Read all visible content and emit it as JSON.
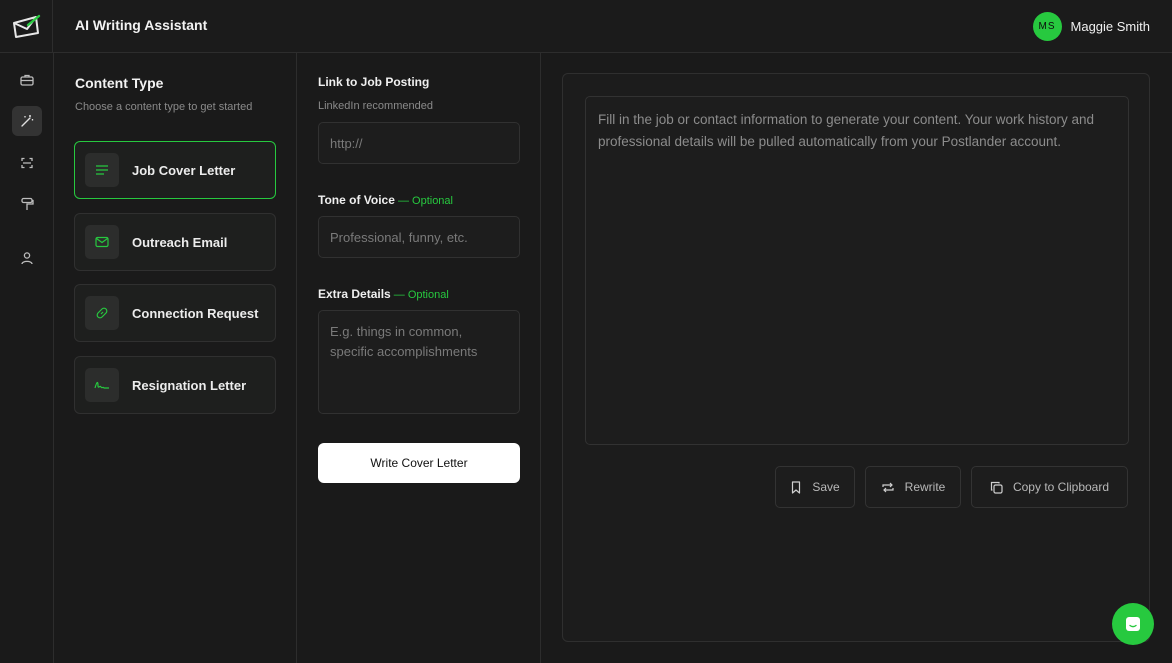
{
  "header": {
    "app_title": "AI Writing Assistant",
    "user": {
      "initials": "MS",
      "name": "Maggie Smith"
    }
  },
  "rail": {
    "icons": [
      "briefcase-icon",
      "magic-wand-icon",
      "scan-icon",
      "paint-roller-icon",
      "user-icon"
    ],
    "active": "magic-wand-icon"
  },
  "content_type": {
    "title": "Content Type",
    "subtitle": "Choose a content type to get started",
    "items": [
      {
        "label": "Job Cover Letter",
        "icon": "lines-icon",
        "selected": true
      },
      {
        "label": "Outreach Email",
        "icon": "mail-icon",
        "selected": false
      },
      {
        "label": "Connection Request",
        "icon": "link-icon",
        "selected": false
      },
      {
        "label": "Resignation Letter",
        "icon": "signature-icon",
        "selected": false
      }
    ]
  },
  "form": {
    "job_link": {
      "label": "Link to Job Posting",
      "hint": "LinkedIn recommended",
      "placeholder": "http://"
    },
    "tone": {
      "label": "Tone of Voice",
      "optional": " — Optional",
      "placeholder": "Professional, funny, etc."
    },
    "extra": {
      "label": "Extra Details",
      "optional": " — Optional",
      "placeholder": "E.g. things in common, specific accomplishments"
    },
    "submit_label": "Write Cover Letter"
  },
  "output": {
    "placeholder": "Fill in the job or contact information to generate your content. Your work history and professional details will be pulled automatically from your Postlander account.",
    "actions": [
      {
        "label": "Save",
        "icon": "bookmark-icon"
      },
      {
        "label": "Rewrite",
        "icon": "repeat-icon"
      },
      {
        "label": "Copy to Clipboard",
        "icon": "copy-icon"
      }
    ]
  },
  "colors": {
    "accent": "#27c93f",
    "background": "#1a1a1a",
    "button": "#ffffff"
  }
}
